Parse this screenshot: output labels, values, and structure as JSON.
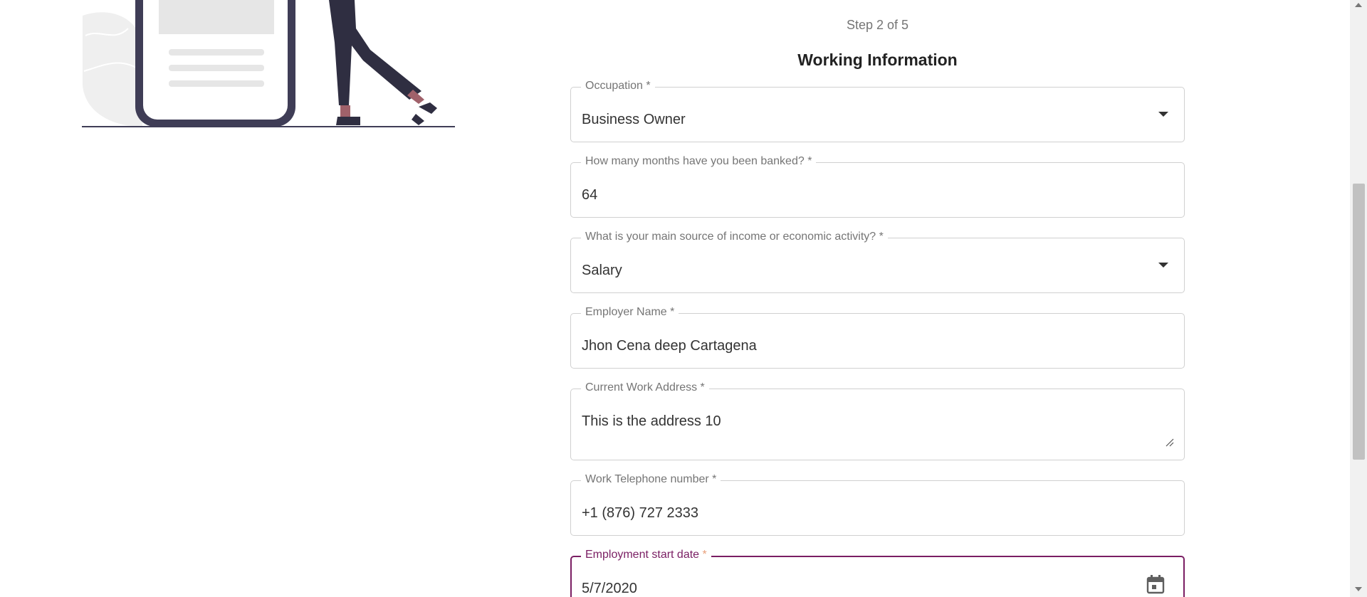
{
  "step": {
    "text": "Step 2 of 5"
  },
  "section_title": "Working Information",
  "fields": {
    "occupation": {
      "label": "Occupation *",
      "value": "Business Owner"
    },
    "months_banked": {
      "label": "How many months have you been banked? *",
      "value": "64"
    },
    "income_source": {
      "label": "What is your main source of income or economic activity? *",
      "value": "Salary"
    },
    "employer_name": {
      "label": "Employer Name *",
      "value": "Jhon Cena deep Cartagena"
    },
    "work_address": {
      "label": "Current Work Address *",
      "value": "This is the address 10"
    },
    "work_phone": {
      "label": "Work Telephone number *",
      "value": "+1 (876) 727 2333"
    },
    "start_date": {
      "label": "Employment start date",
      "required_mark": "*",
      "value": "5/7/2020"
    }
  },
  "icons": {
    "dropdown": "chevron-down-icon",
    "calendar": "calendar-icon",
    "resize": "resize-handle-icon"
  },
  "colors": {
    "accent": "#7a1e63",
    "border": "#d0d0d0",
    "illustration_dark": "#3f3d56",
    "illustration_light": "#e6e6e6"
  }
}
